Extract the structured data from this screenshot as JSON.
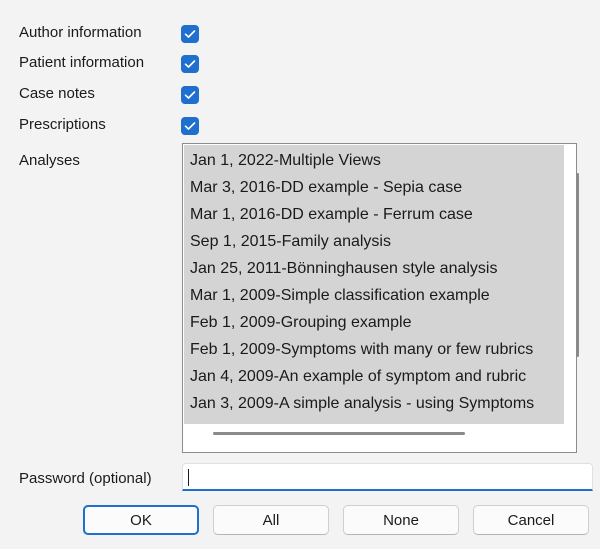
{
  "options": [
    {
      "label": "Author information",
      "checked": true
    },
    {
      "label": "Patient information",
      "checked": true
    },
    {
      "label": "Case notes",
      "checked": true
    },
    {
      "label": "Prescriptions",
      "checked": true
    }
  ],
  "analyses": {
    "label": "Analyses",
    "items": [
      "Jan 1, 2022-Multiple Views",
      "Mar 3, 2016-DD example - Sepia case",
      "Mar 1, 2016-DD example - Ferrum case",
      "Sep 1, 2015-Family analysis",
      "Jan 25, 2011-Bönninghausen style analysis",
      "Mar 1, 2009-Simple classification example",
      "Feb 1, 2009-Grouping example",
      "Feb 1, 2009-Symptoms with many or few rubrics",
      "Jan 4, 2009-An example of symptom and rubric",
      "Jan 3, 2009-A simple analysis - using Symptoms"
    ]
  },
  "password": {
    "label": "Password (optional)",
    "value": ""
  },
  "buttons": {
    "ok": "OK",
    "all": "All",
    "none": "None",
    "cancel": "Cancel"
  },
  "colors": {
    "accent": "#1f6fcf",
    "selection": "#d4d4d4",
    "background": "#f3f3f3"
  }
}
